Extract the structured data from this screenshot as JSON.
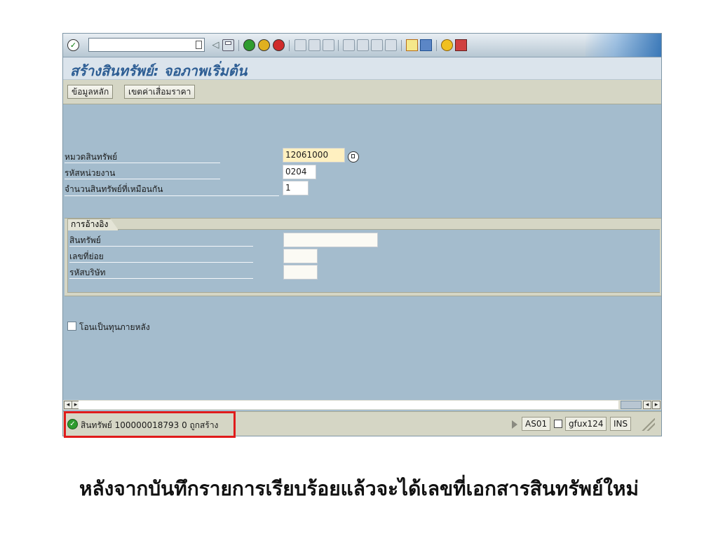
{
  "window": {
    "title": "สร้างสินทรัพย์: จอภาพเริ่มต้น"
  },
  "toolbar": {
    "command_field_value": "",
    "icons": [
      "ok-icon",
      "back-icon",
      "save-icon",
      "back-green-icon",
      "exit-icon",
      "cancel-icon",
      "print-icon",
      "find-icon",
      "find-next-icon",
      "first-page-icon",
      "prev-page-icon",
      "next-page-icon",
      "last-page-icon",
      "create-session-icon",
      "shortcut-icon",
      "help-icon",
      "layout-icon"
    ]
  },
  "app_toolbar": {
    "buttons": [
      "ข้อมูลหลัก",
      "เขตค่าเสื่อมราคา"
    ]
  },
  "form": {
    "asset_class": {
      "label": "หมวดสินทรัพย์",
      "value": "12061000"
    },
    "company_unit": {
      "label": "รหัสหน่วยงาน",
      "value": "0204"
    },
    "num_similar": {
      "label": "จำนวนสินทรัพย์ที่เหมือนกัน",
      "value": "1"
    }
  },
  "reference": {
    "tab_label": "การอ้างอิง",
    "asset_label": "สินทรัพย์",
    "subnumber_label": "เลขที่ย่อย",
    "company_code_label": "รหัสบริษัท",
    "asset_value": "",
    "subnumber_value": "",
    "company_code_value": ""
  },
  "checkbox": {
    "label": "โอนเป็นทุนภายหลัง",
    "checked": false
  },
  "status": {
    "message": "สินทรัพย์ 100000018793 0 ถูกสร้าง",
    "transaction": "AS01",
    "server": "gfux124",
    "mode": "INS"
  },
  "caption": "หลังจากบันทึกรายการเรียบร้อยแล้วจะได้เลขที่เอกสารสินทรัพย์ใหม่",
  "colors": {
    "body_bg": "#a4bccd",
    "highlight": "#e01b1b",
    "title_color": "#2e5e94",
    "required_field": "#fff0c0"
  }
}
